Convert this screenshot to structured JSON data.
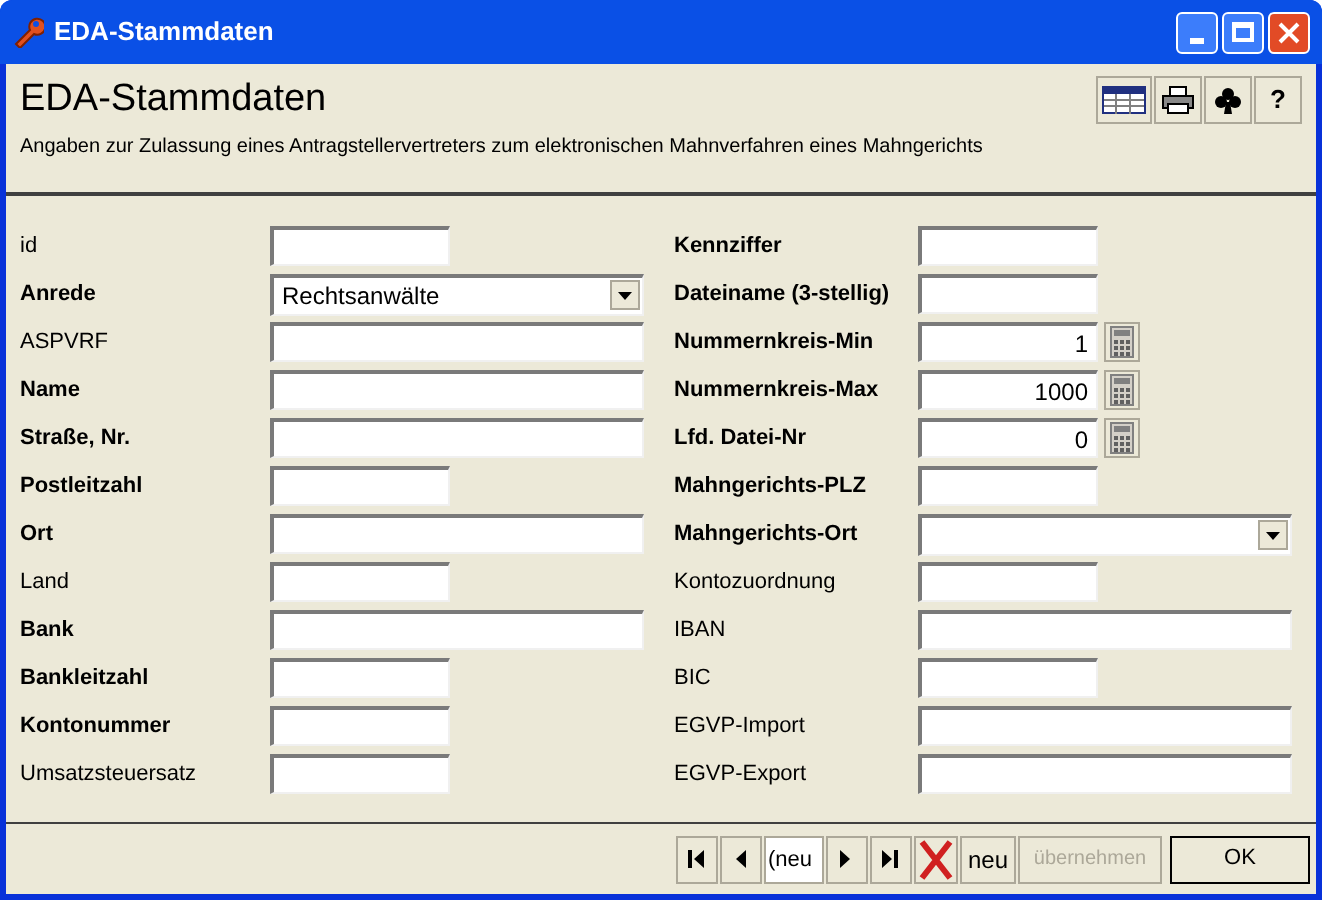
{
  "window": {
    "title": "EDA-Stammdaten"
  },
  "header": {
    "title": "EDA-Stammdaten",
    "subtitle": "Angaben zur Zulassung eines Antragstellervertreters zum elektronischen Mahnverfahren eines Mahngerichts",
    "help_label": "?"
  },
  "left_fields": [
    {
      "label": "id",
      "required": false,
      "kind": "text",
      "wide": false
    },
    {
      "label": "Anrede",
      "required": true,
      "kind": "combo",
      "wide": true,
      "value": "Rechtsanwälte"
    },
    {
      "label": "ASPVRF",
      "required": false,
      "kind": "text",
      "wide": true
    },
    {
      "label": "Name",
      "required": true,
      "kind": "text",
      "wide": true
    },
    {
      "label": "Straße, Nr.",
      "required": true,
      "kind": "text",
      "wide": true
    },
    {
      "label": "Postleitzahl",
      "required": true,
      "kind": "text",
      "wide": false
    },
    {
      "label": "Ort",
      "required": true,
      "kind": "text",
      "wide": true
    },
    {
      "label": "Land",
      "required": false,
      "kind": "text",
      "wide": false
    },
    {
      "label": "Bank",
      "required": true,
      "kind": "text",
      "wide": true
    },
    {
      "label": "Bankleitzahl",
      "required": true,
      "kind": "text",
      "wide": false
    },
    {
      "label": "Kontonummer",
      "required": true,
      "kind": "text",
      "wide": false
    },
    {
      "label": "Umsatzsteuersatz",
      "required": false,
      "kind": "text",
      "wide": false
    }
  ],
  "right_fields": [
    {
      "label": "Kennziffer",
      "required": true,
      "kind": "text",
      "wide": false
    },
    {
      "label": "Dateiname (3-stellig)",
      "required": true,
      "kind": "text",
      "wide": false
    },
    {
      "label": "Nummernkreis-Min",
      "required": true,
      "kind": "number",
      "wide": false,
      "value": "1"
    },
    {
      "label": "Nummernkreis-Max",
      "required": true,
      "kind": "number",
      "wide": false,
      "value": "1000"
    },
    {
      "label": "Lfd. Datei-Nr",
      "required": true,
      "kind": "number",
      "wide": false,
      "value": "0"
    },
    {
      "label": "Mahngerichts-PLZ",
      "required": true,
      "kind": "text",
      "wide": false
    },
    {
      "label": "Mahngerichts-Ort",
      "required": true,
      "kind": "combo",
      "wide": true
    },
    {
      "label": "Kontozuordnung",
      "required": false,
      "kind": "text",
      "wide": false
    },
    {
      "label": "IBAN",
      "required": false,
      "kind": "text",
      "wide": true
    },
    {
      "label": "BIC",
      "required": false,
      "kind": "text",
      "wide": false
    },
    {
      "label": "EGVP-Import",
      "required": false,
      "kind": "text",
      "wide": true
    },
    {
      "label": "EGVP-Export",
      "required": false,
      "kind": "text",
      "wide": true
    }
  ],
  "footer": {
    "record_field": "(neu",
    "new_label": "neu",
    "apply": {
      "label": "übernehmen",
      "disabled": true
    },
    "ok": {
      "label": "OK",
      "disabled": false
    }
  }
}
